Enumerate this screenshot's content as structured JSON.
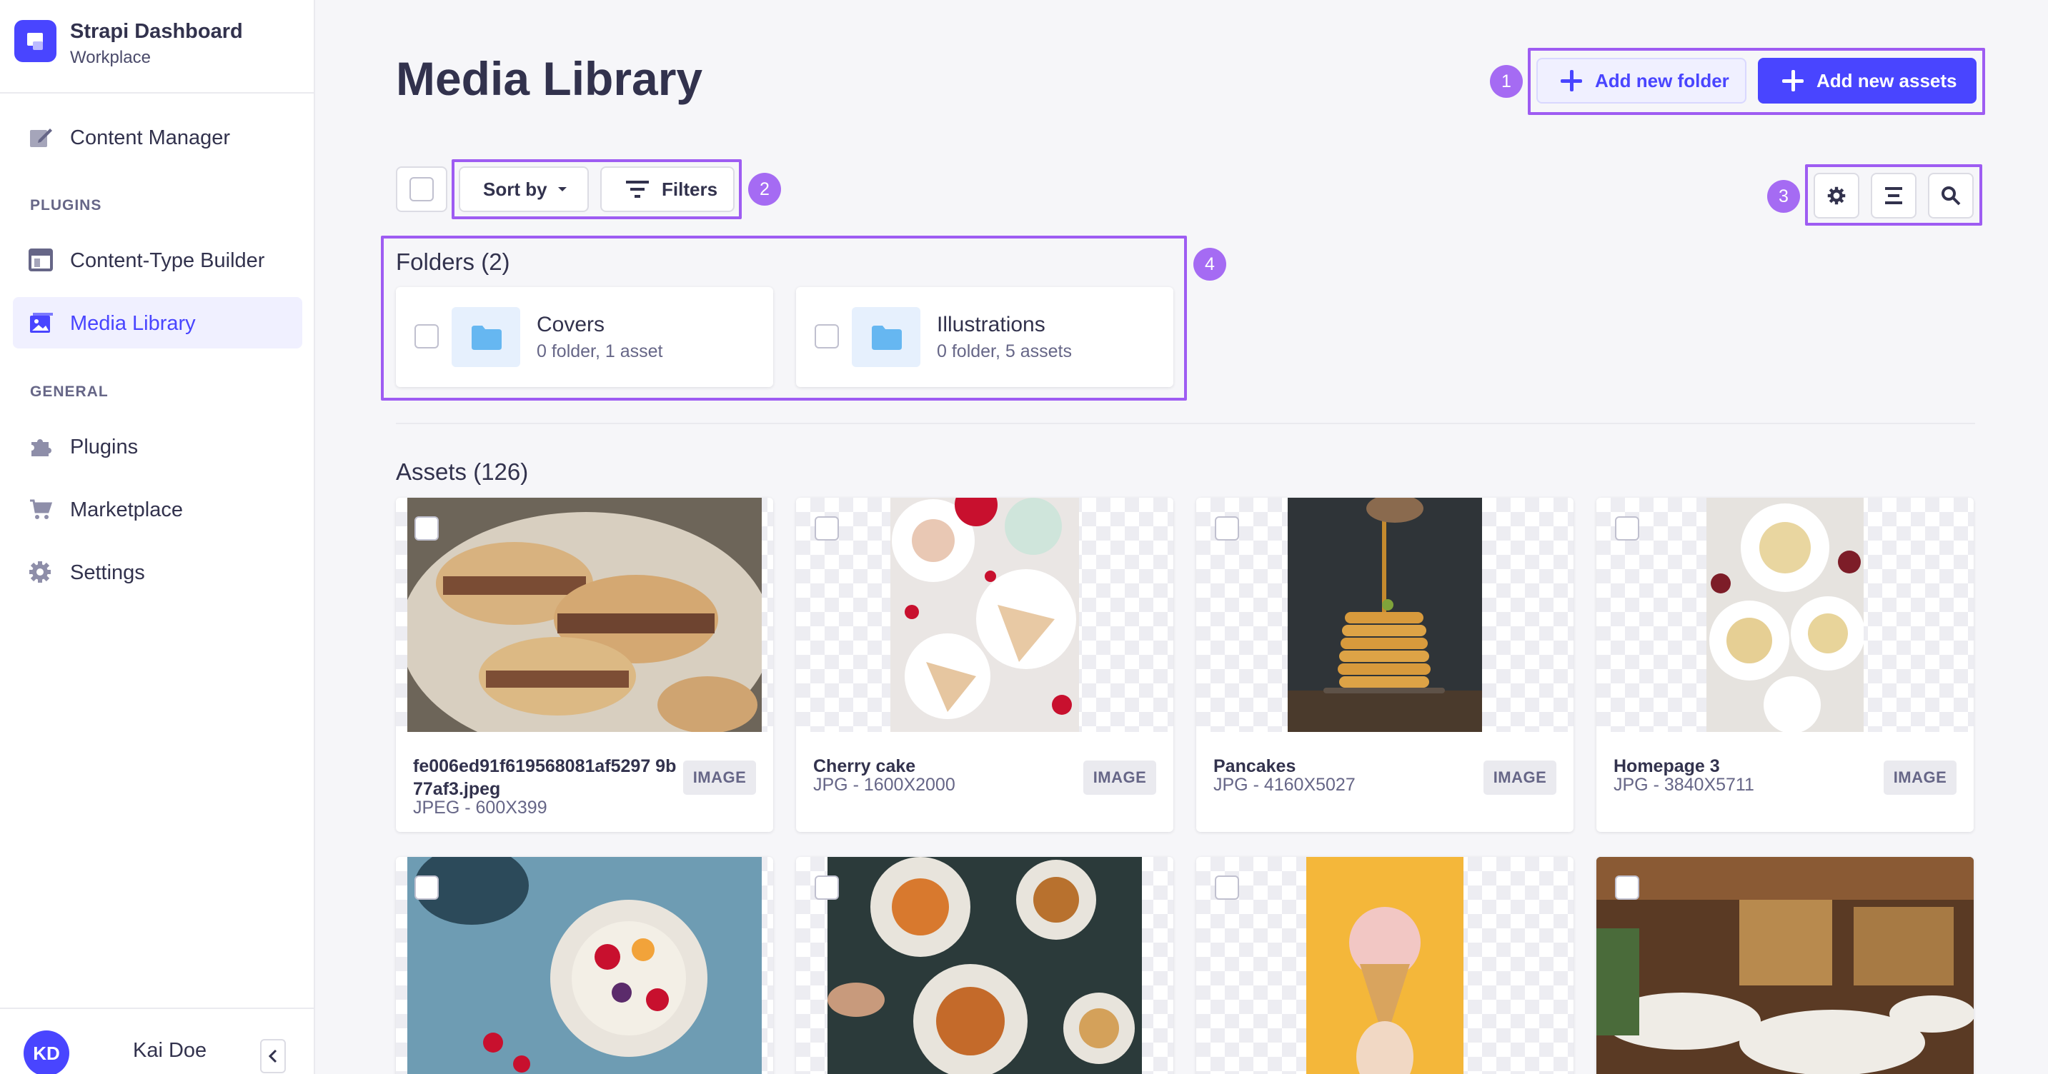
{
  "brand": {
    "title": "Strapi Dashboard",
    "subtitle": "Workplace"
  },
  "sidebar": {
    "content_manager": "Content Manager",
    "plugins_heading": "PLUGINS",
    "content_type_builder": "Content-Type Builder",
    "media_library": "Media Library",
    "general_heading": "GENERAL",
    "plugins": "Plugins",
    "marketplace": "Marketplace",
    "settings": "Settings"
  },
  "user": {
    "initials": "KD",
    "name": "Kai Doe",
    "collapse_icon": "chevron-left-icon"
  },
  "page": {
    "title": "Media Library"
  },
  "actions": {
    "add_folder": "Add new folder",
    "add_assets": "Add new assets"
  },
  "toolbar": {
    "sort_by": "Sort by",
    "filters": "Filters",
    "settings_icon": "gear-icon",
    "view_icon": "list-view-icon",
    "search_icon": "search-icon"
  },
  "callouts": [
    "1",
    "2",
    "3",
    "4"
  ],
  "folders": {
    "heading": "Folders (2)",
    "items": [
      {
        "name": "Covers",
        "meta": "0 folder, 1 asset"
      },
      {
        "name": "Illustrations",
        "meta": "0 folder, 5 assets"
      }
    ]
  },
  "assets": {
    "heading": "Assets (126)",
    "items": [
      {
        "name": "fe006ed91f619568081af5297 9b77af3.jpeg",
        "meta": "JPEG - 600X399",
        "type": "IMAGE"
      },
      {
        "name": "Cherry cake",
        "meta": "JPG - 1600X2000",
        "type": "IMAGE"
      },
      {
        "name": "Pancakes",
        "meta": "JPG - 4160X5027",
        "type": "IMAGE"
      },
      {
        "name": "Homepage 3",
        "meta": "JPG - 3840X5711",
        "type": "IMAGE"
      }
    ]
  },
  "colors": {
    "primary": "#4945ff",
    "callout": "#9e5cf2",
    "folder": "#0c75af"
  }
}
